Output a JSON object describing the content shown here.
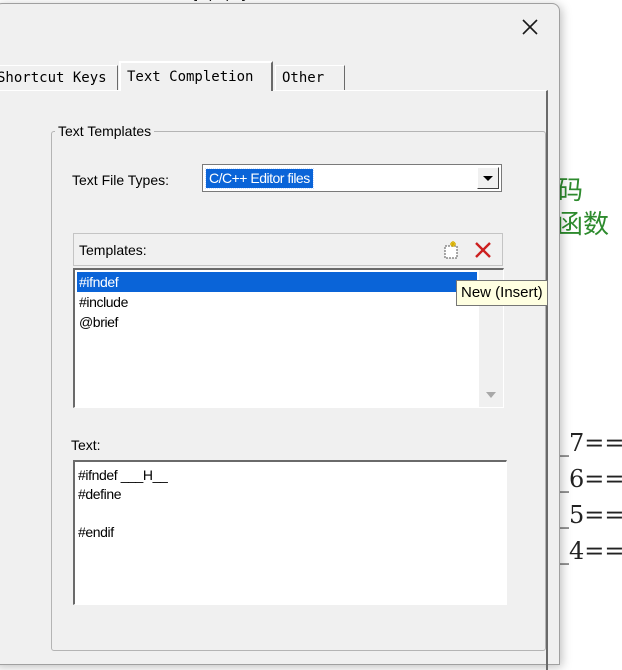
{
  "background": {
    "code_fragment": "{ ; ; }",
    "cjk_line_1": "码",
    "cjk_line_2": "函数",
    "code_lines": [
      "_7==",
      "_6==",
      "_5==",
      "_4=="
    ]
  },
  "dialog": {
    "close_glyph": "✕",
    "tabs": [
      {
        "label": "Shortcut Keys",
        "active": false
      },
      {
        "label": "Text Completion",
        "active": true
      },
      {
        "label": "Other",
        "active": false
      }
    ],
    "group_title": "Text Templates",
    "file_types": {
      "label": "Text File Types:",
      "value": "C/C++ Editor files"
    },
    "templates": {
      "label": "Templates:",
      "new_button_icon": "new-file-icon",
      "delete_button_icon": "delete-x-icon",
      "items": [
        "#ifndef",
        "#include",
        "@brief"
      ],
      "selected_index": 0
    },
    "tooltip": "New (Insert)",
    "text": {
      "label": "Text:",
      "lines": [
        "#ifndef ___H__",
        "#define",
        "",
        "#endif"
      ]
    }
  },
  "colors": {
    "selection": "#0a64d8",
    "delete_icon": "#cc1f1f",
    "cjk_text": "#2e8b2e",
    "dialog_bg": "#f0f0f0",
    "tooltip_bg": "#ffffe1"
  }
}
